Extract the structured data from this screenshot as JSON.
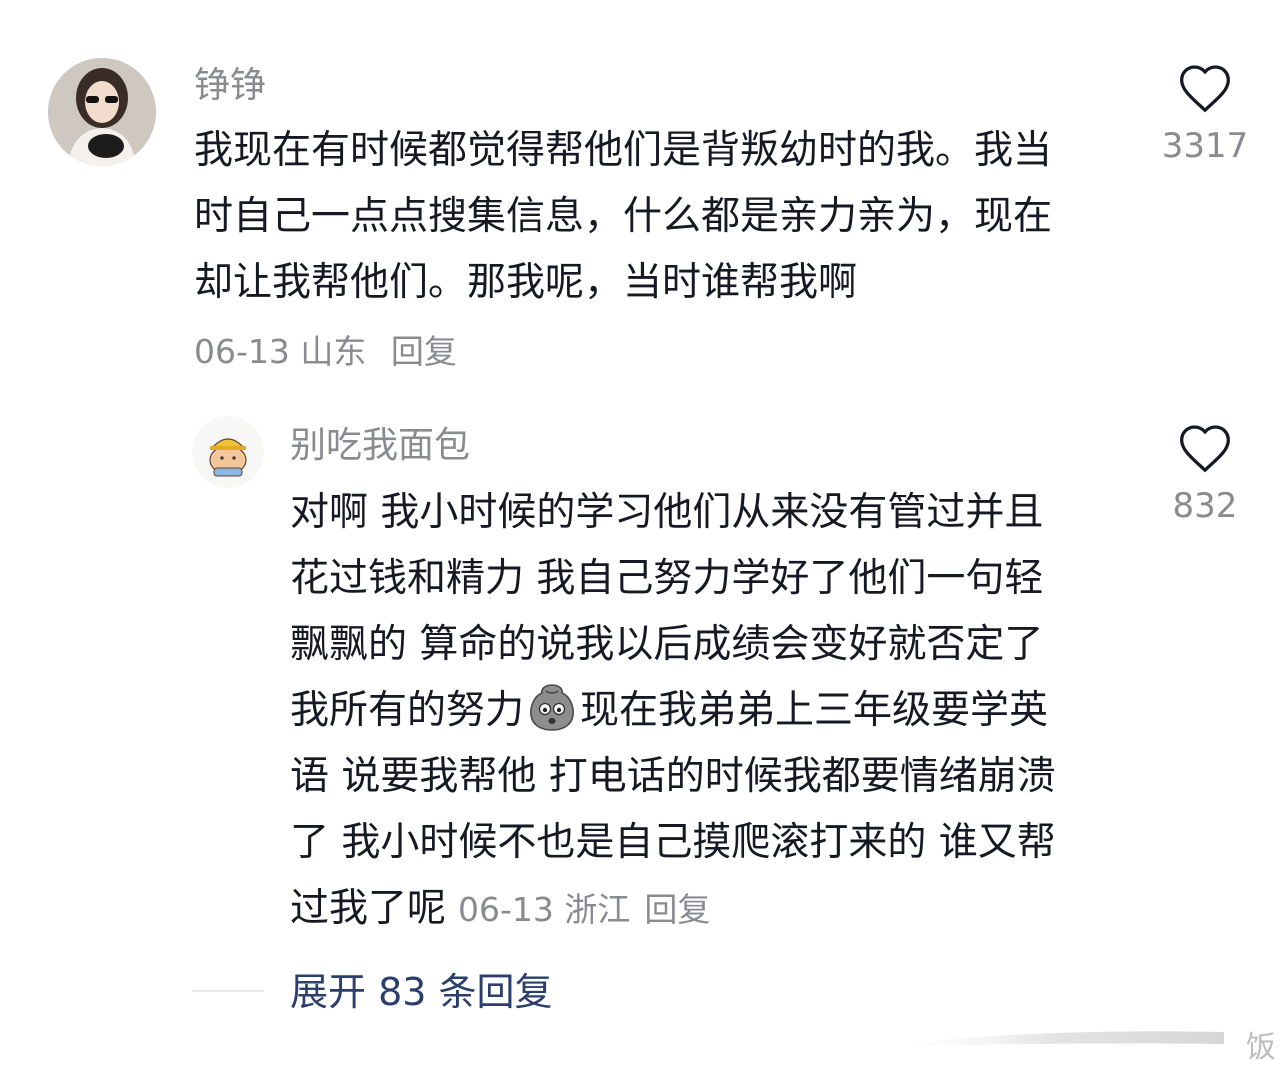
{
  "comment": {
    "username": "铮铮",
    "lines": [
      "我现在有时候都觉得帮他们是背叛幼时的我。我当",
      "时自己一点点搜集信息，什么都是亲力亲为，现在",
      "却让我帮他们。那我呢，当时谁帮我啊"
    ],
    "date": "06-13",
    "location": "山东",
    "reply_label": "回复",
    "likes": "3317"
  },
  "reply": {
    "username": "别吃我面包",
    "lines": [
      "对啊 我小时候的学习他们从来没有管过并且",
      "花过钱和精力 我自己努力学好了他们一句轻",
      "飘飘的 算命的说我以后成绩会变好就否定了"
    ],
    "line4_before": "我所有的努力",
    "line4_after": "现在我弟弟上三年级要学英",
    "lines_after": [
      "语 说要我帮他 打电话的时候我都要情绪崩溃",
      "了 我小时候不也是自己摸爬滚打来的 谁又帮"
    ],
    "last_line": "过我了呢",
    "date": "06-13",
    "location": "浙江",
    "reply_label": "回复",
    "likes": "832",
    "emoji_icon": "sad-face-emoji-icon"
  },
  "expand": {
    "label": "展开 83 条回复"
  },
  "watermark": {
    "text": "饭"
  },
  "colors": {
    "text": "#161823",
    "secondary": "#8a8b91",
    "link": "#2a3f6b"
  }
}
